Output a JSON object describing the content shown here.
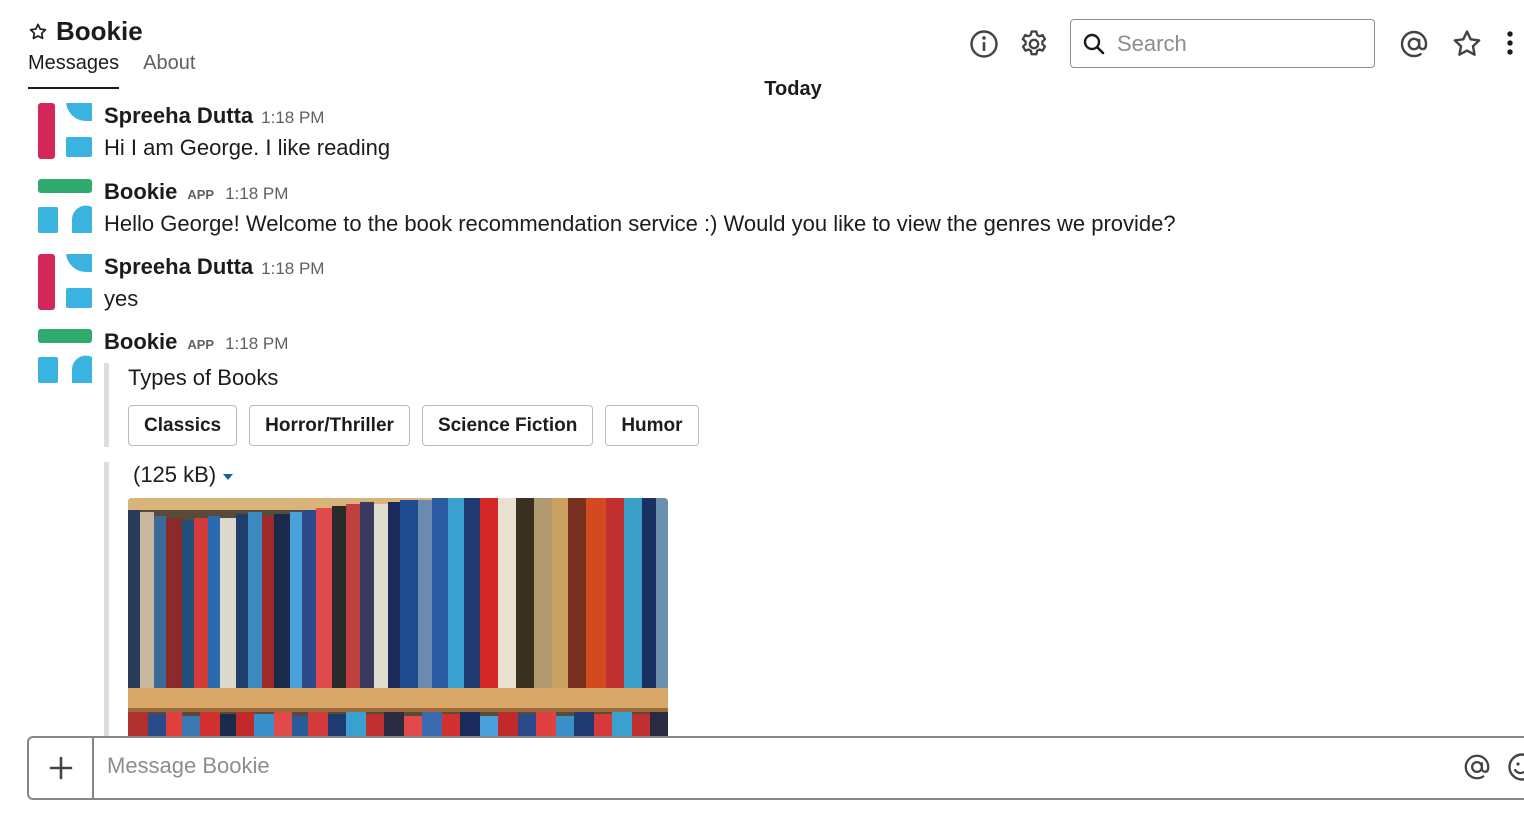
{
  "header": {
    "title": "Bookie",
    "tabs": [
      "Messages",
      "About"
    ],
    "search_placeholder": "Search",
    "icons": [
      "star-outline-icon",
      "info-icon",
      "gear-icon",
      "search-icon",
      "at-icon",
      "star-icon",
      "more-vertical-icon"
    ]
  },
  "day_divider": "Today",
  "messages": [
    {
      "sender": "Spreeha Dutta",
      "time": "1:18 PM",
      "text": "Hi I am George. I like reading"
    },
    {
      "sender": "Bookie",
      "tag": "APP",
      "time": "1:18 PM",
      "text": "Hello George! Welcome to the book recommendation service :) Would you like to view the genres we provide?"
    },
    {
      "sender": "Spreeha Dutta",
      "time": "1:18 PM",
      "text": "yes"
    },
    {
      "sender": "Bookie",
      "tag": "APP",
      "time": "1:18 PM",
      "attachment": {
        "title": "Types of Books",
        "buttons": [
          "Classics",
          "Horror/Thriller",
          "Science Fiction",
          "Humor"
        ]
      },
      "file": {
        "size": "(125 kB)"
      }
    }
  ],
  "composer": {
    "placeholder": "Message Bookie",
    "icons": [
      "plus-icon",
      "at-icon",
      "emoji-icon"
    ]
  },
  "colors": {
    "avatar_red": "#d4265a",
    "avatar_blue": "#3bb3e0",
    "avatar_green": "#2eab6d",
    "link_blue": "#1264a3"
  }
}
